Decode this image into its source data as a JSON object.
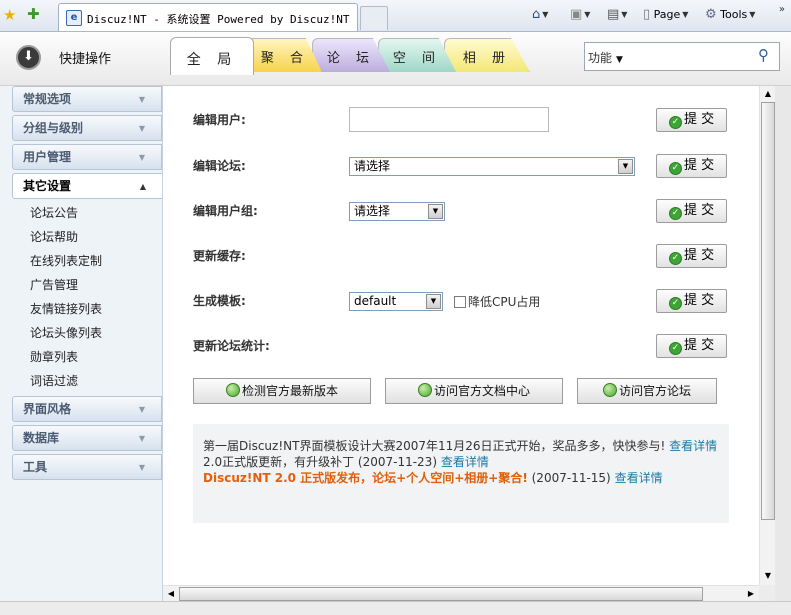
{
  "browser": {
    "tab_title": "Discuz!NT - 系统设置 Powered by Discuz!NT",
    "page_label": "Page",
    "tools_label": "Tools",
    "expand_glyph": "»"
  },
  "nav": {
    "quick_ops_label": "快捷操作",
    "tabs": [
      "全 局",
      "聚 合",
      "论 坛",
      "空 间",
      "相 册"
    ],
    "function_label": "功能"
  },
  "sidebar": {
    "sections": [
      {
        "label": "常规选项"
      },
      {
        "label": "分组与级别"
      },
      {
        "label": "用户管理"
      },
      {
        "label": "其它设置"
      }
    ],
    "active_items": [
      "论坛公告",
      "论坛帮助",
      "在线列表定制",
      "广告管理",
      "友情链接列表",
      "论坛头像列表",
      "勋章列表",
      "词语过滤"
    ],
    "bottom_sections": [
      {
        "label": "界面风格"
      },
      {
        "label": "数据库"
      },
      {
        "label": "工具"
      }
    ]
  },
  "form": {
    "rows": [
      {
        "label": "编辑用户:"
      },
      {
        "label": "编辑论坛:",
        "select_value": "请选择"
      },
      {
        "label": "编辑用户组:",
        "select_value": "请选择"
      },
      {
        "label": "更新缓存:"
      },
      {
        "label": "生成模板:",
        "select_value": "default"
      },
      {
        "label": "更新论坛统计:"
      }
    ],
    "submit_label": "提 交",
    "checkbox_label": "降低CPU占用"
  },
  "actions": {
    "check_version": "检测官方最新版本",
    "visit_docs": "访问官方文档中心",
    "visit_forum": "访问官方论坛"
  },
  "news": [
    {
      "text": "第一届Discuz!NT界面模板设计大赛2007年11月26日正式开始，奖品多多，快快参与!",
      "link": "查看详情"
    },
    {
      "text": "2.0正式版更新，有升级补丁 (2007-11-23)",
      "link": "查看详情"
    },
    {
      "hot": "Discuz!NT 2.0 正式版发布，论坛+个人空间+相册+聚合!",
      "text": " (2007-11-15)",
      "link": "查看详情"
    }
  ]
}
